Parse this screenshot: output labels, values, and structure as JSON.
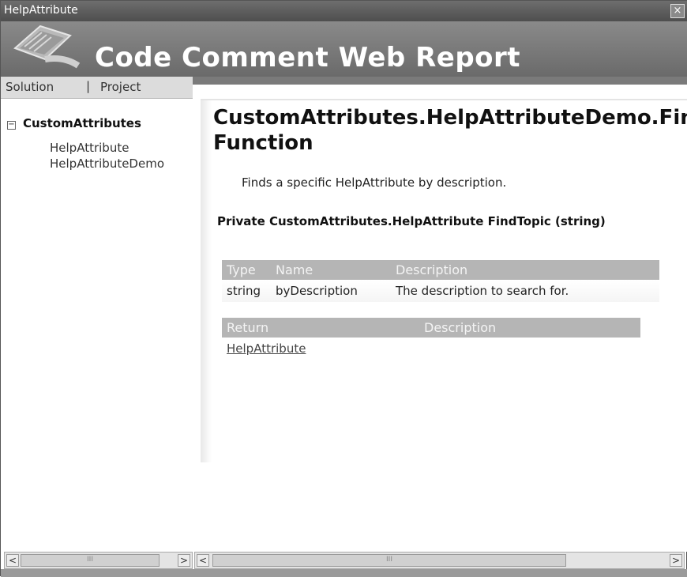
{
  "window": {
    "title": "HelpAttribute",
    "close_glyph": "×"
  },
  "banner": {
    "report_title": "Code Comment Web Report",
    "logo": "code-document-logo"
  },
  "nav": {
    "solution": "Solution",
    "separator": "|",
    "project": "Project"
  },
  "tree": {
    "expander": "−",
    "root": "CustomAttributes",
    "children": [
      "HelpAttribute",
      "HelpAttributeDemo"
    ]
  },
  "content": {
    "title_line1": "CustomAttributes.HelpAttributeDemo.FindTopic",
    "title_line2": "Function",
    "summary": "Finds a specific HelpAttribute by description.",
    "signature": "Private CustomAttributes.HelpAttribute FindTopic (string)",
    "params": {
      "headers": {
        "type": "Type",
        "name": "Name",
        "description": "Description"
      },
      "rows": [
        {
          "type": "string",
          "name": "byDescription",
          "description": "The description to search for."
        }
      ]
    },
    "returns": {
      "headers": {
        "return": "Return",
        "description": "Description"
      },
      "rows": [
        {
          "return": "HelpAttribute",
          "description": ""
        }
      ]
    }
  },
  "scrollbars": {
    "left_arrow": "<",
    "right_arrow": ">",
    "grip": "III"
  }
}
